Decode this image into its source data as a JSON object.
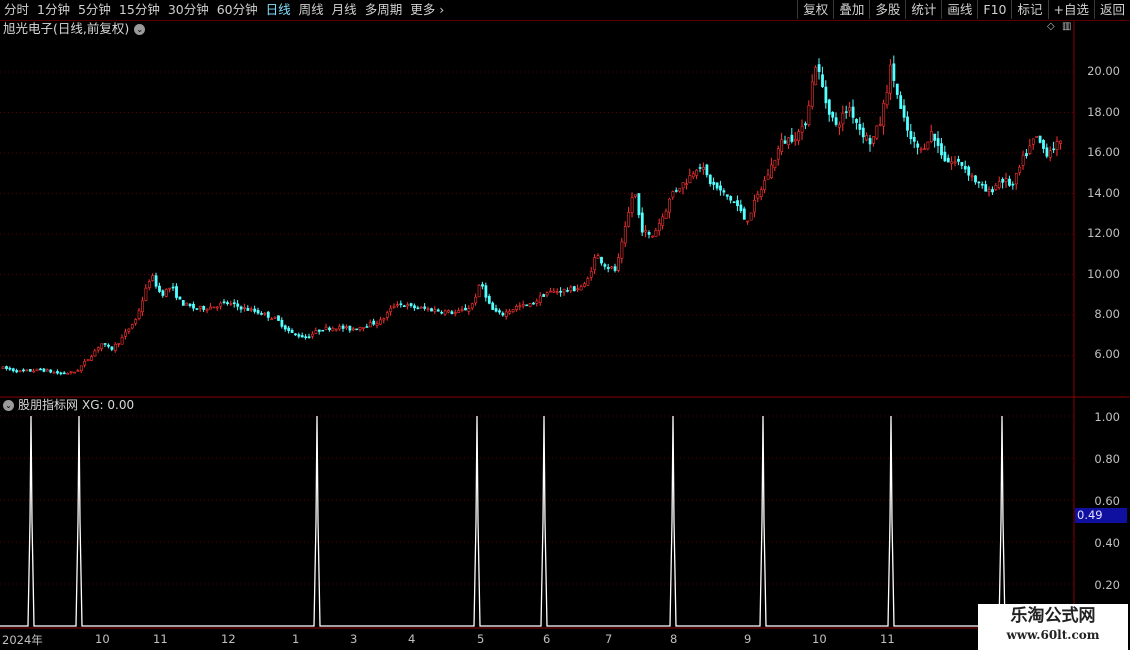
{
  "toolbar": {
    "periods": [
      "分时",
      "1分钟",
      "5分钟",
      "15分钟",
      "30分钟",
      "60分钟",
      "日线",
      "周线",
      "月线",
      "多周期",
      "更多"
    ],
    "active_period": "日线",
    "buttons": [
      "复权",
      "叠加",
      "多股",
      "统计",
      "画线",
      "F10",
      "标记",
      "+自选",
      "返回"
    ]
  },
  "stock": {
    "title": "旭光电子(日线,前复权)"
  },
  "indicator": {
    "name": "股朋指标网",
    "value_text": "XG: 0.00",
    "badge_value": "0.49"
  },
  "price_axis": [
    "20.00",
    "18.00",
    "16.00",
    "14.00",
    "12.00",
    "10.00",
    "8.00",
    "6.00"
  ],
  "indicator_axis": [
    "1.00",
    "0.80",
    "0.60",
    "0.40",
    "0.20"
  ],
  "time_axis": [
    "2024年",
    "10",
    "11",
    "12",
    "1",
    "3",
    "4",
    "5",
    "6",
    "7",
    "8",
    "9",
    "10",
    "11"
  ],
  "colors": {
    "up": "#ff3232",
    "down": "#54ffff",
    "grid": "#5a0000",
    "signal": "#ffffff"
  },
  "watermark": {
    "line1": "乐淘公式网",
    "line2": "www.60lt.com"
  },
  "chart_data": [
    {
      "type": "candlestick",
      "title": "旭光电子(日线,前复权)",
      "ylim": [
        4.0,
        21.5
      ],
      "close_trace": [
        [
          0,
          5.4
        ],
        [
          20,
          5.2
        ],
        [
          40,
          5.3
        ],
        [
          60,
          5.1
        ],
        [
          75,
          5.2
        ],
        [
          90,
          6.0
        ],
        [
          100,
          6.6
        ],
        [
          110,
          6.3
        ],
        [
          120,
          6.8
        ],
        [
          135,
          7.8
        ],
        [
          150,
          10.0
        ],
        [
          160,
          9.0
        ],
        [
          170,
          9.4
        ],
        [
          180,
          8.6
        ],
        [
          195,
          8.3
        ],
        [
          210,
          8.4
        ],
        [
          225,
          8.6
        ],
        [
          245,
          8.3
        ],
        [
          260,
          8.1
        ],
        [
          275,
          7.8
        ],
        [
          290,
          7.1
        ],
        [
          305,
          6.9
        ],
        [
          320,
          7.3
        ],
        [
          335,
          7.4
        ],
        [
          350,
          7.3
        ],
        [
          365,
          7.5
        ],
        [
          380,
          7.7
        ],
        [
          395,
          8.6
        ],
        [
          410,
          8.4
        ],
        [
          425,
          8.3
        ],
        [
          440,
          8.2
        ],
        [
          455,
          8.1
        ],
        [
          470,
          8.4
        ],
        [
          480,
          9.6
        ],
        [
          490,
          8.3
        ],
        [
          500,
          8.0
        ],
        [
          515,
          8.4
        ],
        [
          530,
          8.5
        ],
        [
          545,
          9.1
        ],
        [
          560,
          9.2
        ],
        [
          575,
          9.3
        ],
        [
          585,
          9.5
        ],
        [
          595,
          11.0
        ],
        [
          605,
          10.4
        ],
        [
          615,
          10.2
        ],
        [
          625,
          12.4
        ],
        [
          633,
          14.3
        ],
        [
          640,
          12.3
        ],
        [
          650,
          11.8
        ],
        [
          662,
          12.9
        ],
        [
          672,
          14.1
        ],
        [
          685,
          14.6
        ],
        [
          698,
          15.5
        ],
        [
          710,
          14.5
        ],
        [
          722,
          14.0
        ],
        [
          735,
          13.5
        ],
        [
          745,
          12.6
        ],
        [
          758,
          14.0
        ],
        [
          770,
          15.3
        ],
        [
          780,
          16.5
        ],
        [
          792,
          16.8
        ],
        [
          803,
          17.2
        ],
        [
          815,
          20.5
        ],
        [
          825,
          18.5
        ],
        [
          835,
          17.3
        ],
        [
          848,
          18.3
        ],
        [
          860,
          17.1
        ],
        [
          870,
          16.5
        ],
        [
          880,
          17.6
        ],
        [
          890,
          20.3
        ],
        [
          900,
          18.0
        ],
        [
          910,
          16.6
        ],
        [
          920,
          16.1
        ],
        [
          930,
          17.0
        ],
        [
          945,
          15.6
        ],
        [
          960,
          15.5
        ],
        [
          975,
          14.6
        ],
        [
          987,
          14.0
        ],
        [
          1000,
          14.7
        ],
        [
          1012,
          14.4
        ],
        [
          1022,
          15.7
        ],
        [
          1035,
          16.8
        ],
        [
          1045,
          16.0
        ],
        [
          1055,
          16.4
        ],
        [
          1063,
          16.4
        ]
      ]
    },
    {
      "type": "line",
      "name": "XG",
      "ylim": [
        0,
        1.0
      ],
      "signal_x_positions": [
        31,
        79,
        317,
        477,
        544,
        673,
        763,
        891,
        1002
      ],
      "baseline": 0
    }
  ]
}
